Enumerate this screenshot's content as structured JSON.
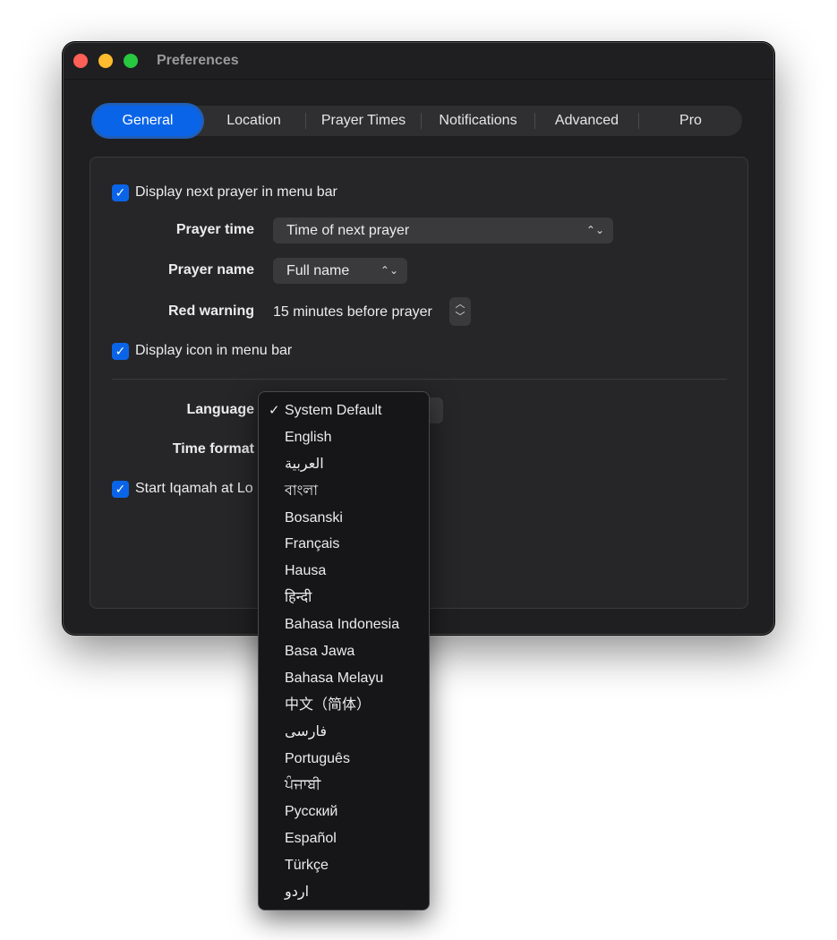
{
  "window": {
    "title": "Preferences"
  },
  "tabs": [
    {
      "label": "General",
      "active": true
    },
    {
      "label": "Location",
      "active": false
    },
    {
      "label": "Prayer Times",
      "active": false
    },
    {
      "label": "Notifications",
      "active": false
    },
    {
      "label": "Advanced",
      "active": false
    },
    {
      "label": "Pro",
      "active": false
    }
  ],
  "general": {
    "display_next_prayer": {
      "label": "Display next prayer in menu bar",
      "checked": true
    },
    "prayer_time": {
      "label": "Prayer time",
      "value": "Time of next prayer"
    },
    "prayer_name": {
      "label": "Prayer name",
      "value": "Full name"
    },
    "red_warning": {
      "label": "Red warning",
      "value": "15 minutes before prayer"
    },
    "display_icon": {
      "label": "Display icon in menu bar",
      "checked": true
    },
    "language": {
      "label": "Language"
    },
    "time_format": {
      "label": "Time format"
    },
    "start_iqamah": {
      "label": "Start Iqamah at Lo",
      "checked": true
    }
  },
  "language_menu": {
    "selected": "System Default",
    "items": [
      "System Default",
      "English",
      "العربية",
      "বাংলা",
      "Bosanski",
      "Français",
      "Hausa",
      "हिन्दी",
      "Bahasa Indonesia",
      "Basa Jawa",
      "Bahasa Melayu",
      "中文（简体）",
      "فارسی",
      "Português",
      "ਪੰਜਾਬੀ",
      "Русский",
      "Español",
      "Türkçe",
      "اردو"
    ]
  },
  "icons": {
    "check": "✓",
    "popup_chevron": "⌃⌄",
    "stepper_up": "︿",
    "stepper_down": "﹀"
  },
  "colors": {
    "accent": "#0a64e8",
    "window_bg": "#1f1f21",
    "panel_bg": "#262628",
    "menu_bg": "#161618"
  }
}
